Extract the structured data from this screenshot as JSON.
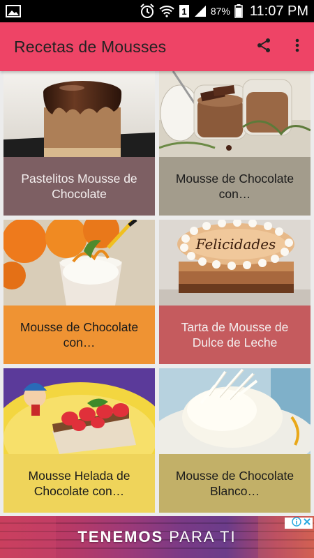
{
  "status_bar": {
    "battery_percent": "87%",
    "time": "11:07 PM",
    "sim_badge": "1",
    "icons": [
      "image-icon",
      "alarm-icon",
      "wifi-icon",
      "sim-icon",
      "signal-icon",
      "battery-icon"
    ]
  },
  "app_bar": {
    "title": "Recetas de Mousses",
    "color": "#ee4466",
    "actions": [
      "share-icon",
      "overflow-menu-icon"
    ]
  },
  "recipes": [
    {
      "title": "Pastelitos  Mousse de Chocolate",
      "caption_color": "#7d5f63"
    },
    {
      "title": "Mousse de Chocolate con…",
      "caption_color": "#a39c8c"
    },
    {
      "title": "Mousse de Chocolate con…",
      "caption_color": "#ef9333"
    },
    {
      "title": "Tarta de Mousse de Dulce de Leche",
      "caption_color": "#c55b5e"
    },
    {
      "title": "Mousse Helada de Chocolate con…",
      "caption_color": "#efd45a"
    },
    {
      "title": "Mousse de Chocolate Blanco…",
      "caption_color": "#c2b068"
    }
  ],
  "cake_text": "Felicidades",
  "ad": {
    "bold_text": "TENEMOS",
    "light_text": "PARA TI",
    "icons": [
      "ad-info-icon",
      "ad-close-icon"
    ]
  }
}
